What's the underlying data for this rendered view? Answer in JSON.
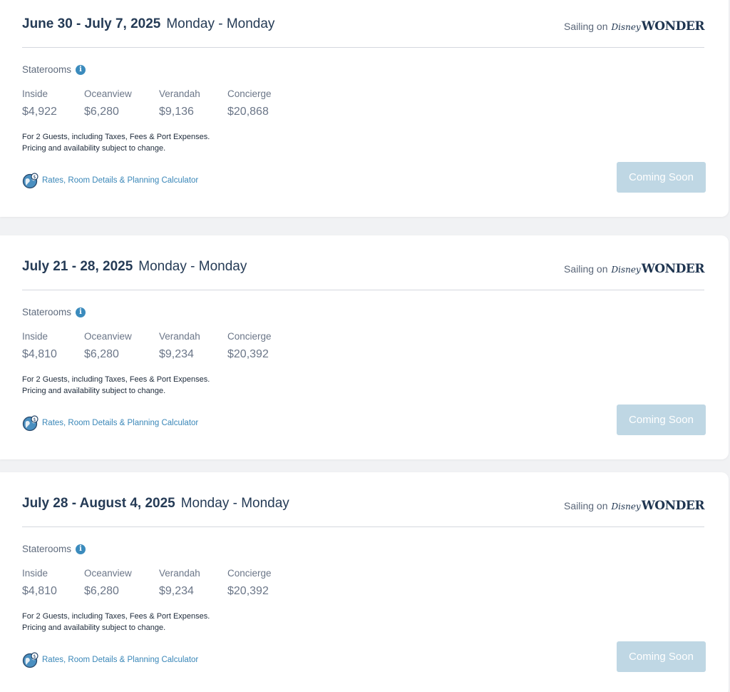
{
  "sailings": [
    {
      "dates": "June 30 - July 7, 2025",
      "days": "Monday - Monday",
      "sailing_prefix": "Sailing on",
      "ship_brand": "Disney",
      "ship_name": "WONDER",
      "staterooms_label": "Staterooms",
      "info_icon": "info-icon",
      "rooms": [
        {
          "name": "Inside",
          "price": "$4,922"
        },
        {
          "name": "Oceanview",
          "price": "$6,280"
        },
        {
          "name": "Verandah",
          "price": "$9,136"
        },
        {
          "name": "Concierge",
          "price": "$20,868"
        }
      ],
      "disclaimer_line1": "For 2 Guests, including Taxes, Fees & Port Expenses.",
      "disclaimer_line2": "Pricing and availability subject to change.",
      "rates_link": "Rates, Room Details & Planning Calculator",
      "button_label": "Coming Soon"
    },
    {
      "dates": "July 21 - 28, 2025",
      "days": "Monday - Monday",
      "sailing_prefix": "Sailing on",
      "ship_brand": "Disney",
      "ship_name": "WONDER",
      "staterooms_label": "Staterooms",
      "info_icon": "info-icon",
      "rooms": [
        {
          "name": "Inside",
          "price": "$4,810"
        },
        {
          "name": "Oceanview",
          "price": "$6,280"
        },
        {
          "name": "Verandah",
          "price": "$9,234"
        },
        {
          "name": "Concierge",
          "price": "$20,392"
        }
      ],
      "disclaimer_line1": "For 2 Guests, including Taxes, Fees & Port Expenses.",
      "disclaimer_line2": "Pricing and availability subject to change.",
      "rates_link": "Rates, Room Details & Planning Calculator",
      "button_label": "Coming Soon"
    },
    {
      "dates": "July 28 - August 4, 2025",
      "days": "Monday - Monday",
      "sailing_prefix": "Sailing on",
      "ship_brand": "Disney",
      "ship_name": "WONDER",
      "staterooms_label": "Staterooms",
      "info_icon": "info-icon",
      "rooms": [
        {
          "name": "Inside",
          "price": "$4,810"
        },
        {
          "name": "Oceanview",
          "price": "$6,280"
        },
        {
          "name": "Verandah",
          "price": "$9,234"
        },
        {
          "name": "Concierge",
          "price": "$20,392"
        }
      ],
      "disclaimer_line1": "For 2 Guests, including Taxes, Fees & Port Expenses.",
      "disclaimer_line2": "Pricing and availability subject to change.",
      "rates_link": "Rates, Room Details & Planning Calculator",
      "button_label": "Coming Soon"
    }
  ],
  "colors": {
    "heading": "#253b56",
    "link": "#3a87b8",
    "button_disabled": "#bfd7e4",
    "info_icon": "#3b8bbd"
  }
}
